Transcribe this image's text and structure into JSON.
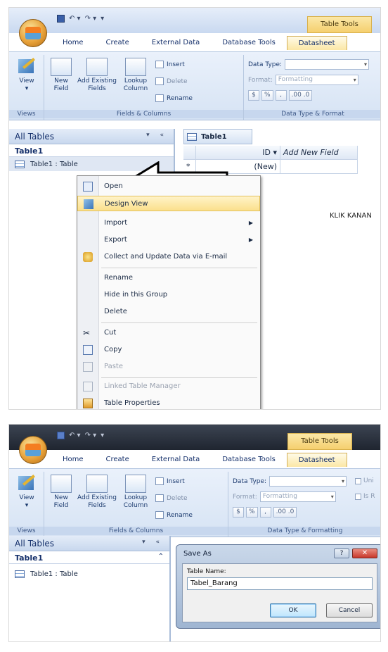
{
  "app": {
    "contextual_tab_title": "Table Tools",
    "tabs": [
      "Home",
      "Create",
      "External Data",
      "Database Tools",
      "Datasheet"
    ],
    "active_tab": "Datasheet"
  },
  "ribbon": {
    "views_group": "Views",
    "view_label": "View",
    "fields_group": "Fields & Columns",
    "new_field": "New Field",
    "add_existing_fields": "Add Existing Fields",
    "lookup_column": "Lookup Column",
    "insert": "Insert",
    "delete": "Delete",
    "rename": "Rename",
    "datatype_group_1": "Data Type & Format",
    "datatype_group_2": "Data Type & Formatting",
    "data_type_label": "Data Type:",
    "format_label": "Format:",
    "format_value": "Formatting",
    "currency": "$",
    "percent": "%",
    "comma": ",",
    "decimals": ".00 .0",
    "unique_label": "Uni",
    "required_label": "Is R"
  },
  "nav": {
    "header": "All Tables",
    "group": "Table1",
    "item": "Table1 : Table"
  },
  "doc": {
    "tab_label": "Table1",
    "col_id": "ID",
    "col_add": "Add New Field",
    "new_row_marker": "*",
    "new_row_value": "(New)"
  },
  "annotation": "KLIK KANAN",
  "context_menu": {
    "items": [
      {
        "label": "Open"
      },
      {
        "label": "Design View"
      },
      {
        "label": "Import"
      },
      {
        "label": "Export"
      },
      {
        "label": "Collect and Update Data via E-mail"
      },
      {
        "label": "Rename"
      },
      {
        "label": "Hide in this Group"
      },
      {
        "label": "Delete"
      },
      {
        "label": "Cut"
      },
      {
        "label": "Copy"
      },
      {
        "label": "Paste"
      },
      {
        "label": "Linked Table Manager"
      },
      {
        "label": "Table Properties"
      }
    ],
    "submenu_arrow": "▶"
  },
  "dialog": {
    "title": "Save As",
    "help": "?",
    "close": "✕",
    "field_label": "Table Name:",
    "field_value": "Tabel_Barang",
    "ok": "OK",
    "cancel": "Cancel"
  }
}
